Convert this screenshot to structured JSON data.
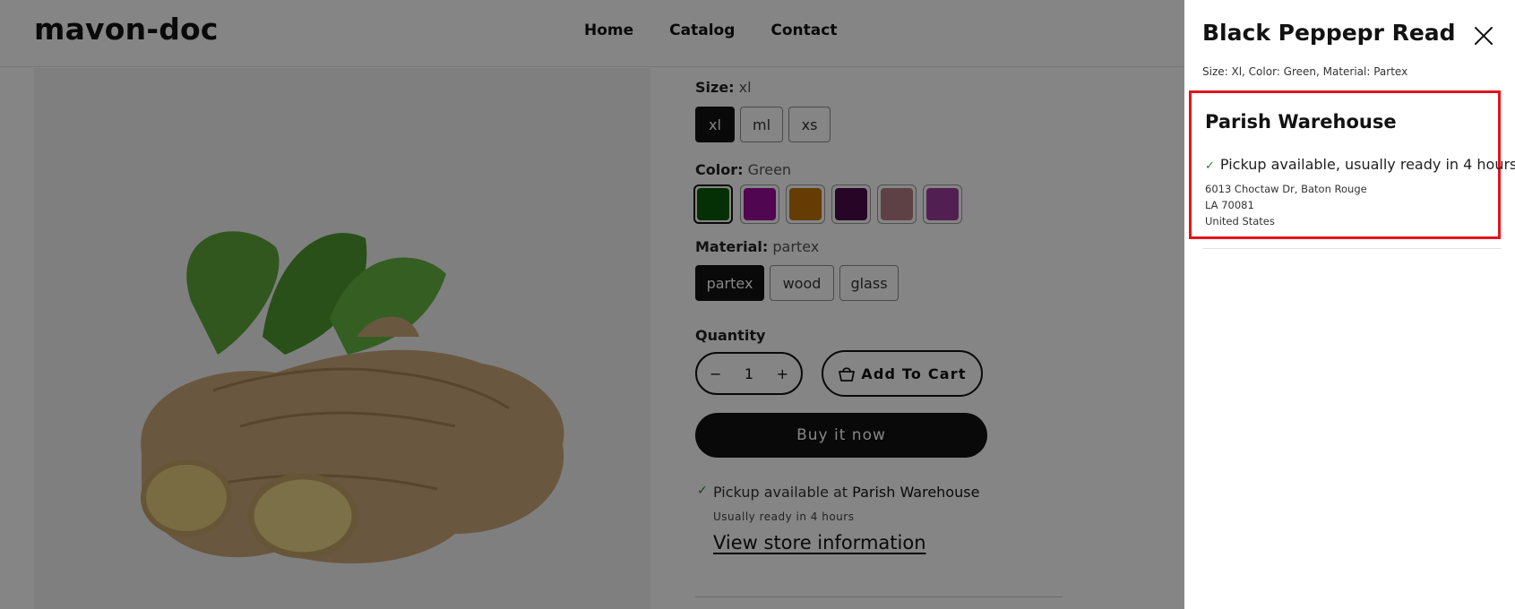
{
  "header": {
    "logo": "mavon-doc",
    "nav": [
      "Home",
      "Catalog",
      "Contact"
    ]
  },
  "product": {
    "size_label": "Size:",
    "size_value": "xl",
    "sizes": [
      "xl",
      "ml",
      "xs"
    ],
    "color_label": "Color:",
    "color_value": "Green",
    "colors": [
      "#0b5a0b",
      "#9a0d9a",
      "#c07309",
      "#4b0b4c",
      "#b57d84",
      "#9c3d9c"
    ],
    "material_label": "Material:",
    "material_value": "partex",
    "materials": [
      "partex",
      "wood",
      "glass"
    ],
    "quantity_label": "Quantity",
    "quantity_minus": "−",
    "quantity_value": "1",
    "quantity_plus": "+",
    "add_to_cart": "Add To Cart",
    "buy_now": "Buy it now",
    "pickup_prefix": "Pickup available at",
    "pickup_store": "Parish Warehouse",
    "pickup_ready": "Usually ready in 4 hours",
    "view_store": "View store information"
  },
  "drawer": {
    "title": "Black Peppepr Read",
    "variant": "Size: Xl, Color: Green, Material: Partex",
    "store_name": "Parish Warehouse",
    "availability": "Pickup available, usually ready in 4 hours",
    "address_line1": "6013 Choctaw Dr, Baton Rouge",
    "address_line2": "LA 70081",
    "address_line3": "United States"
  },
  "colors": {
    "check_green": "#2e7d32",
    "highlight_red": "#e3141b"
  },
  "icons": {
    "check": "check-icon",
    "close": "close-icon",
    "cart": "basket-icon"
  }
}
